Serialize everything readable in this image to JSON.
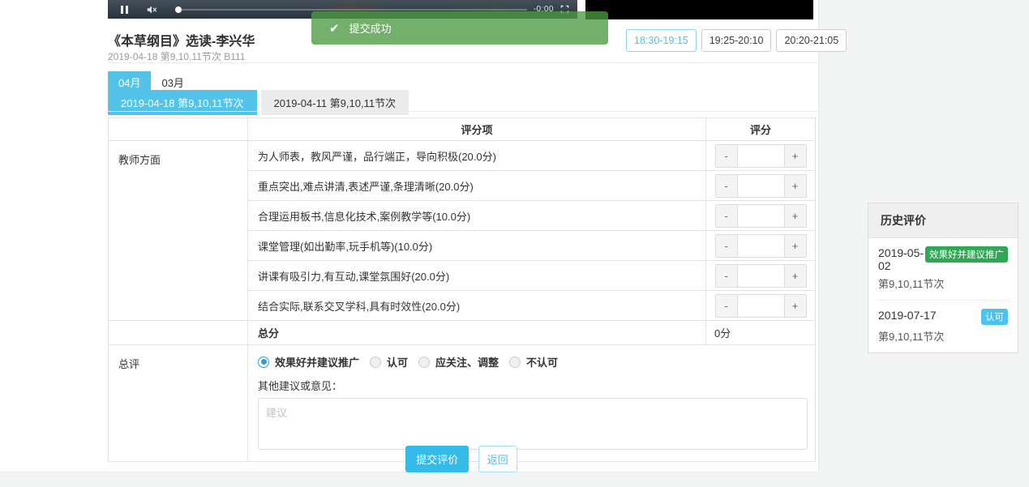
{
  "colors": {
    "accent_blue": "#53c3ea",
    "radio_blue": "#2d9fd8",
    "success_green": "#2fa855",
    "badge_blue": "#4cc3ee",
    "toast_green": "#79b371"
  },
  "player": {
    "time": "-0:00"
  },
  "toast": {
    "check": "✔",
    "message": "提交成功"
  },
  "course": {
    "title": "《本草纲目》选读-李兴华",
    "subtitle": "2019-04-18 第9,10,11节次 B111"
  },
  "time_slots": [
    {
      "label": "18:30-19:15",
      "active": true
    },
    {
      "label": "19:25-20:10",
      "active": false
    },
    {
      "label": "20:20-21:05",
      "active": false
    }
  ],
  "month_tabs": [
    {
      "label": "04月",
      "active": true
    },
    {
      "label": "03月",
      "active": false
    }
  ],
  "session_tabs": [
    {
      "label": "2019-04-18 第9,10,11节次",
      "active": true
    },
    {
      "label": "2019-04-11 第9,10,11节次",
      "active": false
    }
  ],
  "stepper": {
    "minus": "-",
    "plus": "+"
  },
  "table": {
    "headers": {
      "item": "评分项",
      "score": "评分"
    },
    "category": "教师方面",
    "rows": [
      {
        "label": "为人师表，教风严谨，品行端正，导向积极(20.0分)",
        "value": ""
      },
      {
        "label": "重点突出,难点讲清,表述严谨,条理清晰(20.0分)",
        "value": ""
      },
      {
        "label": "合理运用板书,信息化技术,案例教学等(10.0分)",
        "value": ""
      },
      {
        "label": "课堂管理(如出勤率,玩手机等)(10.0分)",
        "value": ""
      },
      {
        "label": "讲课有吸引力,有互动,课堂氛围好(20.0分)",
        "value": ""
      },
      {
        "label": "结合实际,联系交叉学科,具有时效性(20.0分)",
        "value": ""
      }
    ],
    "total_label": "总分",
    "total_value": "0分",
    "overall_label": "总评",
    "radios": [
      {
        "label": "效果好并建议推广",
        "selected": true
      },
      {
        "label": "认可",
        "selected": false
      },
      {
        "label": "应关注、调整",
        "selected": false
      },
      {
        "label": "不认可",
        "selected": false
      }
    ],
    "comment_label": "其他建议或意见：",
    "comment_placeholder": "建议",
    "comment_value": ""
  },
  "actions": {
    "submit": "提交评价",
    "back": "返回"
  },
  "history": {
    "title": "历史评价",
    "items": [
      {
        "date": "2019-05-02",
        "session": "第9,10,11节次",
        "badge": "效果好并建议推广",
        "badge_color": "#2fa855"
      },
      {
        "date": "2019-07-17",
        "session": "第9,10,11节次",
        "badge": "认可",
        "badge_color": "#4cc3ee"
      }
    ]
  }
}
